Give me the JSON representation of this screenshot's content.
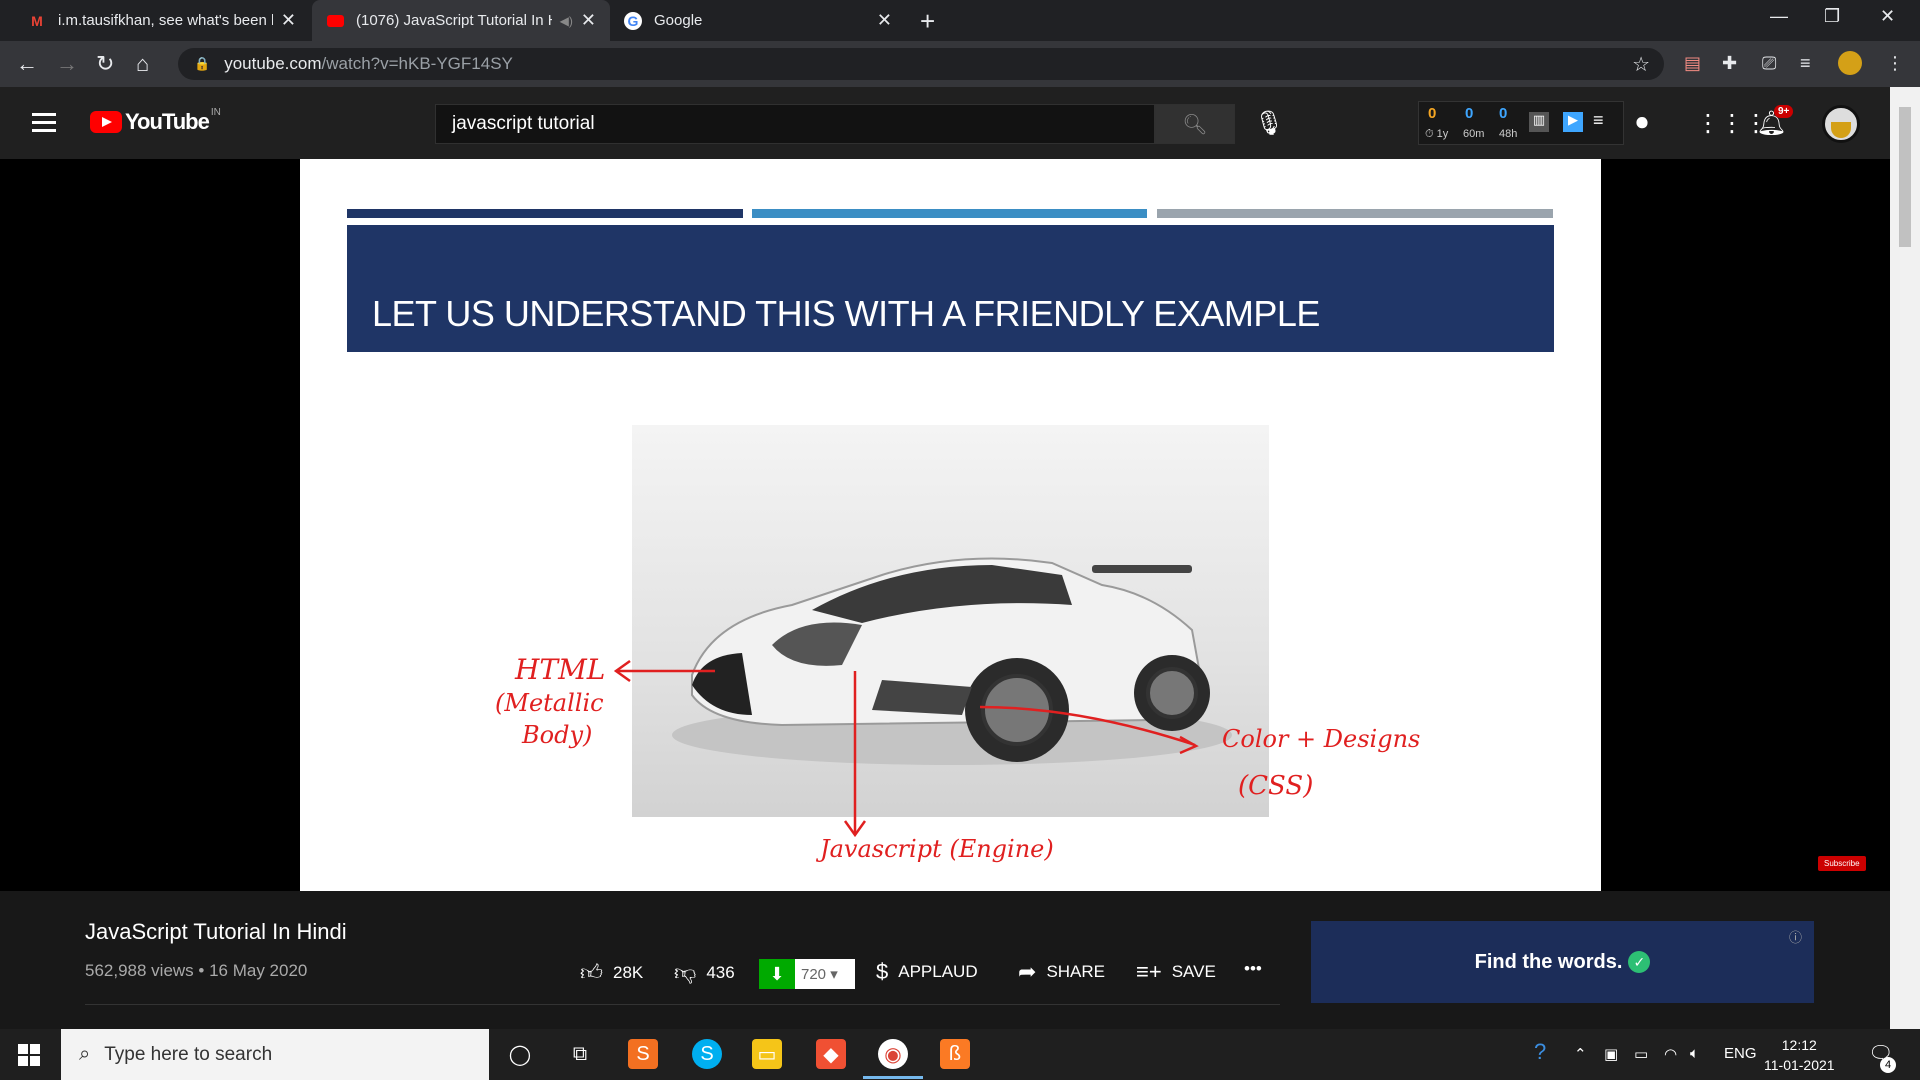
{
  "browser": {
    "tabs": [
      {
        "title": "i.m.tausifkhan, see what's been h",
        "icon": "gmail-icon",
        "active": false
      },
      {
        "title": "(1076) JavaScript Tutorial In H",
        "icon": "youtube-icon",
        "active": true
      },
      {
        "title": "Google",
        "icon": "google-icon",
        "active": false
      }
    ],
    "url_host": "youtube.com",
    "url_path": "/watch?v=hKB-YGF14SY"
  },
  "youtube": {
    "logo_text": "YouTube",
    "region": "IN",
    "search_value": "javascript tutorial",
    "stats": [
      {
        "count": "0",
        "label": "1y",
        "color": "#f5a623"
      },
      {
        "count": "0",
        "label": "60m",
        "color": "#3ea6ff"
      },
      {
        "count": "0",
        "label": "48h",
        "color": "#3ea6ff"
      }
    ],
    "notification_badge": "9+"
  },
  "slide": {
    "heading": "LET US UNDERSTAND THIS WITH A FRIENDLY EXAMPLE",
    "annotations": {
      "html_line1": "HTML",
      "html_line2": "(Metallic",
      "html_line3": "Body)",
      "css_line1": "Color + Designs",
      "css_line2": "(CSS)",
      "js": "Javascript (Engine)"
    },
    "subscribe_watermark": "Subscribe",
    "colors": {
      "banner": "#1f3566",
      "bar1": "#1f3566",
      "bar2": "#3b8ec4",
      "bar3": "#9aa4ad",
      "ink": "#e02020"
    }
  },
  "video": {
    "title": "JavaScript Tutorial In Hindi",
    "meta": "562,988 views • 16 May 2020",
    "likes": "28K",
    "dislikes": "436",
    "download_quality": "720",
    "applaud_label": "APPLAUD",
    "share_label": "SHARE",
    "save_label": "SAVE",
    "more_label": "•••"
  },
  "ad": {
    "text": "Find the words."
  },
  "taskbar": {
    "search_placeholder": "Type here to search",
    "language": "ENG",
    "time": "12:12",
    "date": "11-01-2021",
    "notifications": "4"
  }
}
